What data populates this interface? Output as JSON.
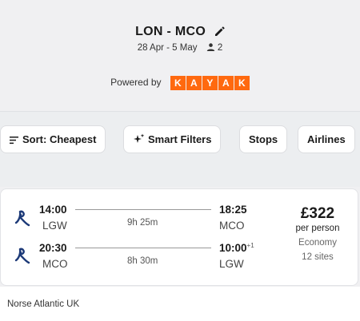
{
  "header": {
    "route": "LON - MCO",
    "dates": "28 Apr - 5 May",
    "travellers": "2",
    "powered_by": "Powered by",
    "brand_letters": [
      "K",
      "A",
      "Y",
      "A",
      "K"
    ],
    "brand_color": "#ff690f"
  },
  "filters": {
    "sort_label": "Sort: Cheapest",
    "smart_filters_label": "Smart Filters",
    "stops_label": "Stops",
    "airlines_label": "Airlines"
  },
  "result": {
    "outbound": {
      "depart_time": "14:00",
      "depart_airport": "LGW",
      "duration": "9h 25m",
      "arrive_time": "18:25",
      "arrive_airport": "MCO"
    },
    "return": {
      "depart_time": "20:30",
      "depart_airport": "MCO",
      "duration": "8h 30m",
      "arrive_time": "10:00",
      "day_offset": "+1",
      "arrive_airport": "LGW"
    },
    "price": "£322",
    "price_note": "per person",
    "cabin": "Economy",
    "sites": "12 sites",
    "airline": "Norse Atlantic UK",
    "logo_color": "#1d3a78"
  },
  "icons": {
    "edit": "pencil-icon",
    "travellers": "person-icon",
    "sort": "sort-icon",
    "smart_filters": "sparkle-icon",
    "airline_logo": "norse-logo-icon"
  }
}
